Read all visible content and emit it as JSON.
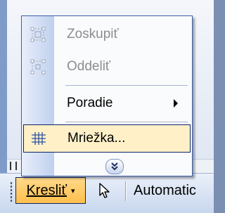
{
  "menu": {
    "items": [
      {
        "label": "Zoskupiť",
        "icon": "group-icon",
        "enabled": false
      },
      {
        "label": "Oddeliť",
        "icon": "ungroup-icon",
        "enabled": false
      },
      {
        "label": "Poradie",
        "icon": "",
        "enabled": true,
        "submenu": true
      },
      {
        "label": "Mriežka...",
        "icon": "grid-icon",
        "enabled": true,
        "highlighted": true
      }
    ],
    "expand_icon": "double-chevron-down-icon"
  },
  "toolbar": {
    "draw_label": "Kresliť",
    "draw_caret": "▾",
    "select_icon": "select-objects-arrow-icon",
    "autoshapes_label": "Automatic"
  },
  "colors": {
    "menu_border": "#3b5fa8",
    "highlight_fill": "#fff0c8",
    "highlight_border": "#0a246a",
    "draw_button_fill": "#ffbf4d",
    "disabled_text": "#8d8d8d"
  }
}
